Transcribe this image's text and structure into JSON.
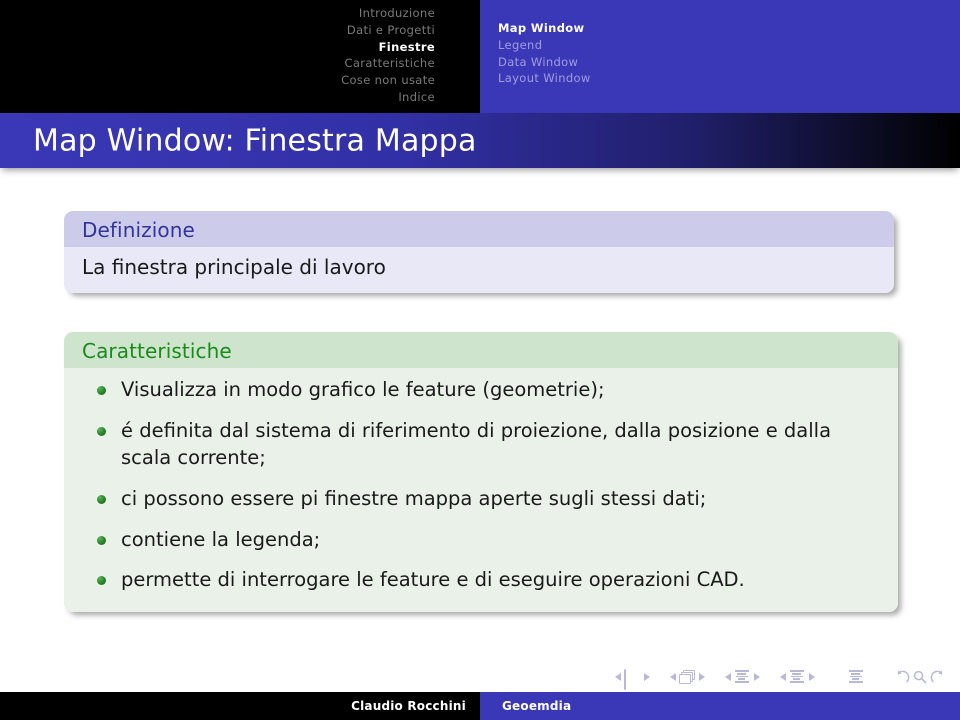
{
  "topnav": {
    "sections": [
      {
        "label": "Introduzione",
        "active": false
      },
      {
        "label": "Dati e Progetti",
        "active": false
      },
      {
        "label": "Finestre",
        "active": true
      },
      {
        "label": "Caratteristiche",
        "active": false
      },
      {
        "label": "Cose non usate",
        "active": false
      },
      {
        "label": "Indice",
        "active": false
      }
    ],
    "subsections": [
      {
        "label": "Map Window",
        "active": true
      },
      {
        "label": "Legend",
        "active": false
      },
      {
        "label": "Data Window",
        "active": false
      },
      {
        "label": "Layout Window",
        "active": false
      }
    ]
  },
  "slide": {
    "title": "Map Window: Finestra Mappa",
    "blocks": [
      {
        "id": "definition",
        "title": "Definizione",
        "body": "La finestra principale di lavoro",
        "title_color": "#33339c",
        "header_bg": "#ccccea",
        "body_bg": "#e8e8f6"
      },
      {
        "id": "caratteristiche",
        "title": "Caratteristiche",
        "title_color": "#1a8a1a",
        "header_bg": "#cfe4cd",
        "body_bg": "#e9f1e8",
        "bullets": [
          "Visualizza in modo grafico le feature (geometrie);",
          "é definita dal sistema di riferimento di proiezione, dalla posizione e dalla scala corrente;",
          "ci possono essere pi finestre mappa aperte sugli stessi dati;",
          "contiene la legenda;",
          "permette di interrogare le feature e di eseguire operazioni CAD."
        ]
      }
    ]
  },
  "navsymbols": {
    "items": [
      {
        "name": "slide-icon",
        "prev": "previous-slide",
        "next": "next-slide"
      },
      {
        "name": "frame-icon",
        "prev": "previous-frame",
        "next": "next-frame"
      },
      {
        "name": "subsection-icon",
        "prev": "previous-subsection",
        "next": "next-subsection"
      },
      {
        "name": "section-icon",
        "prev": "previous-section",
        "next": "next-section"
      }
    ],
    "presentation_icon": "presentation-icon",
    "back_icon": "back-arrow-icon",
    "search_icon": "search-icon",
    "forward_icon": "forward-arrow-icon"
  },
  "footer": {
    "author": "Claudio Rocchini",
    "subject": "Geoemdia"
  },
  "colors": {
    "brand_blue": "#3b38b8",
    "black": "#000000",
    "nav_inactive": "#7a7a7a",
    "subnav_inactive": "#9f9de0",
    "bullet_green": "#2e8b2e",
    "navsym": "#b8b8d8"
  }
}
